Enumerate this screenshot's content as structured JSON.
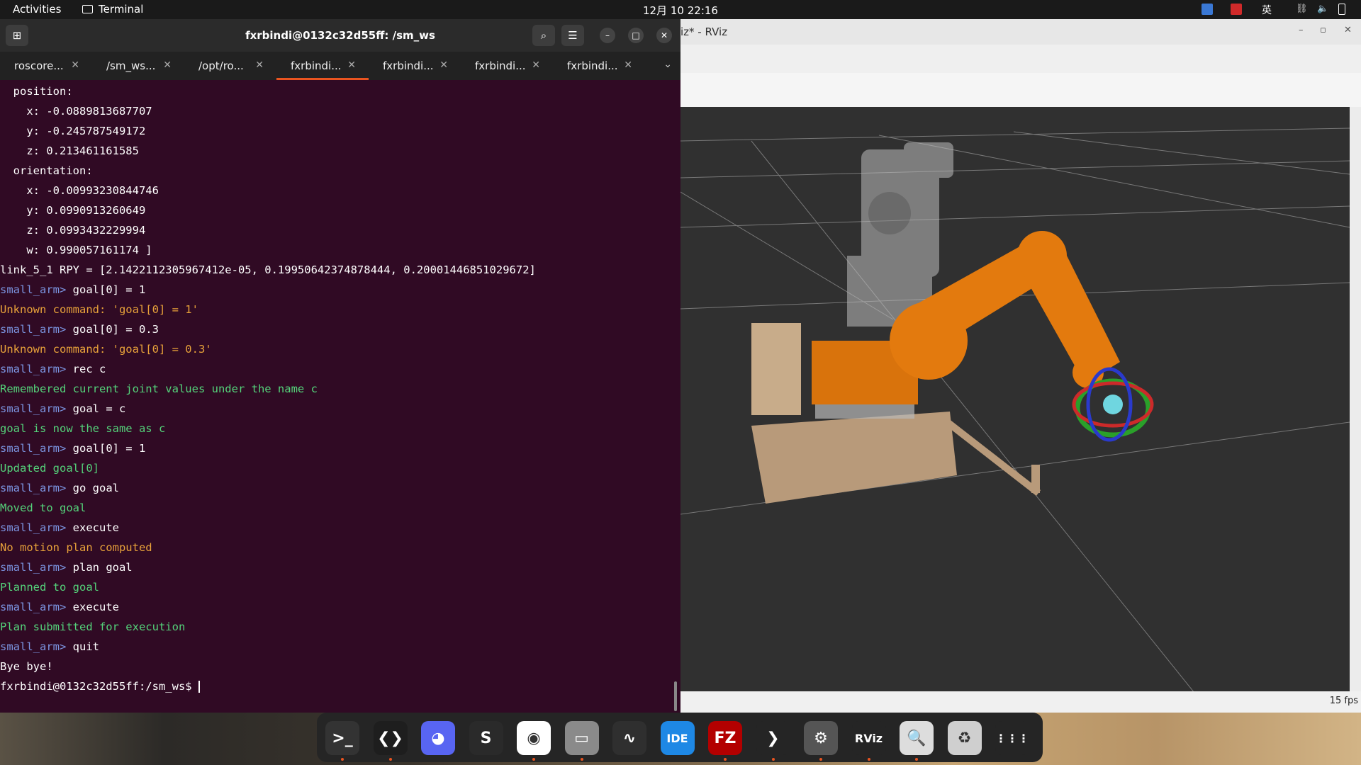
{
  "topbar": {
    "activities": "Activities",
    "app_name": "Terminal",
    "clock": "12月 10  22:16",
    "ime": "英"
  },
  "terminal": {
    "title": "fxrbindi@0132c32d55ff: /sm_ws",
    "tabs": [
      {
        "label": "roscore..."
      },
      {
        "label": "/sm_ws..."
      },
      {
        "label": "/opt/ro..."
      },
      {
        "label": "fxrbindi..."
      },
      {
        "label": "fxrbindi..."
      },
      {
        "label": "fxrbindi..."
      },
      {
        "label": "fxrbindi..."
      }
    ],
    "active_tab": 3,
    "lines": [
      {
        "t": "  position: ",
        "c": "white"
      },
      {
        "t": "    x: -0.0889813687707",
        "c": "white"
      },
      {
        "t": "    y: -0.245787549172",
        "c": "white"
      },
      {
        "t": "    z: 0.213461161585",
        "c": "white"
      },
      {
        "t": "  orientation: ",
        "c": "white"
      },
      {
        "t": "    x: -0.00993230844746",
        "c": "white"
      },
      {
        "t": "    y: 0.0990913260649",
        "c": "white"
      },
      {
        "t": "    z: 0.0993432229994",
        "c": "white"
      },
      {
        "t": "    w: 0.990057161174 ]",
        "c": "white"
      },
      {
        "t": "link_5_1 RPY = [2.1422112305967412e-05, 0.19950642374878444, 0.20001446851029672]",
        "c": "white"
      },
      {
        "p": "small_arm> ",
        "t": "goal[0] = 1",
        "c": "white"
      },
      {
        "t": "Unknown command: 'goal[0] = 1'",
        "c": "orange"
      },
      {
        "p": "small_arm> ",
        "t": "goal[0] = 0.3",
        "c": "white"
      },
      {
        "t": "Unknown command: 'goal[0] = 0.3'",
        "c": "orange"
      },
      {
        "p": "small_arm> ",
        "t": "rec c",
        "c": "white"
      },
      {
        "t": "Remembered current joint values under the name c",
        "c": "green"
      },
      {
        "p": "small_arm> ",
        "t": "goal = c",
        "c": "white"
      },
      {
        "t": "goal is now the same as c",
        "c": "green"
      },
      {
        "p": "small_arm> ",
        "t": "goal[0] = 1",
        "c": "white"
      },
      {
        "t": "Updated goal[0]",
        "c": "green"
      },
      {
        "p": "small_arm> ",
        "t": "go goal",
        "c": "white"
      },
      {
        "t": "Moved to goal",
        "c": "green"
      },
      {
        "p": "small_arm> ",
        "t": "execute",
        "c": "white"
      },
      {
        "t": "No motion plan computed",
        "c": "orange"
      },
      {
        "p": "small_arm> ",
        "t": "plan goal",
        "c": "white"
      },
      {
        "t": "Planned to goal",
        "c": "green"
      },
      {
        "p": "small_arm> ",
        "t": "execute",
        "c": "white"
      },
      {
        "t": "Plan submitted for execution",
        "c": "green"
      },
      {
        "p": "small_arm> ",
        "t": "quit",
        "c": "white"
      },
      {
        "t": "Bye bye!",
        "c": "white"
      },
      {
        "t": "fxrbindi@0132c32d55ff:/sm_ws$ ",
        "c": "white",
        "cursor": true
      }
    ]
  },
  "rviz": {
    "title": "iz* - RViz",
    "fps": "15 fps"
  },
  "dock": {
    "apps": [
      {
        "name": "terminal-icon",
        "bg": "#333333",
        "glyph": ">_",
        "running": true
      },
      {
        "name": "vscode-icon",
        "bg": "#1e1e1e",
        "glyph": "❮❯",
        "running": true
      },
      {
        "name": "discord-icon",
        "bg": "#5865f2",
        "glyph": "◕",
        "running": false
      },
      {
        "name": "sublime-icon",
        "bg": "#2a2a2a",
        "glyph": "S",
        "running": false
      },
      {
        "name": "chrome-icon",
        "bg": "#ffffff",
        "glyph": "◉",
        "running": true
      },
      {
        "name": "files-icon",
        "bg": "#8a8a8a",
        "glyph": "▭",
        "running": true
      },
      {
        "name": "system-monitor-icon",
        "bg": "#2f2f2f",
        "glyph": "∿",
        "running": false
      },
      {
        "name": "ide-icon",
        "bg": "#1e88e5",
        "glyph": "IDE",
        "running": false
      },
      {
        "name": "filezilla-icon",
        "bg": "#b30000",
        "glyph": "FZ",
        "running": true
      },
      {
        "name": "remote-icon",
        "bg": "#252525",
        "glyph": "❯",
        "running": true
      },
      {
        "name": "settings-icon",
        "bg": "#555555",
        "glyph": "⚙",
        "running": true
      },
      {
        "name": "rviz-icon",
        "bg": "#252525",
        "glyph": "RViz",
        "running": true
      },
      {
        "name": "image-viewer-icon",
        "bg": "#dddddd",
        "glyph": "🔍",
        "running": true
      },
      {
        "name": "trash-icon",
        "bg": "#cfcfcf",
        "glyph": "♻",
        "running": false
      },
      {
        "name": "app-grid-icon",
        "bg": "#252525",
        "glyph": "⋮⋮⋮",
        "running": false
      }
    ]
  }
}
